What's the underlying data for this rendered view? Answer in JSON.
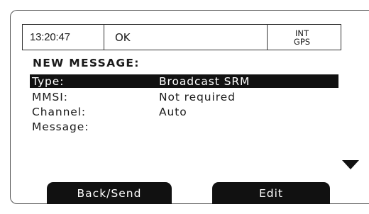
{
  "status": {
    "time": "13:20:47",
    "state": "OK",
    "source_line1": "INT",
    "source_line2": "GPS"
  },
  "screen": {
    "heading": "NEW MESSAGE:",
    "fields": [
      {
        "label": "Type:",
        "value": "Broadcast SRM",
        "selected": true
      },
      {
        "label": "MMSI:",
        "value": "Not required",
        "selected": false
      },
      {
        "label": "Channel:",
        "value": "Auto",
        "selected": false
      },
      {
        "label": "Message:",
        "value": "",
        "selected": false
      }
    ]
  },
  "softkeys": {
    "left": "Back/Send",
    "right": "Edit"
  },
  "icons": {
    "scroll": "scroll-down-arrow-icon"
  }
}
